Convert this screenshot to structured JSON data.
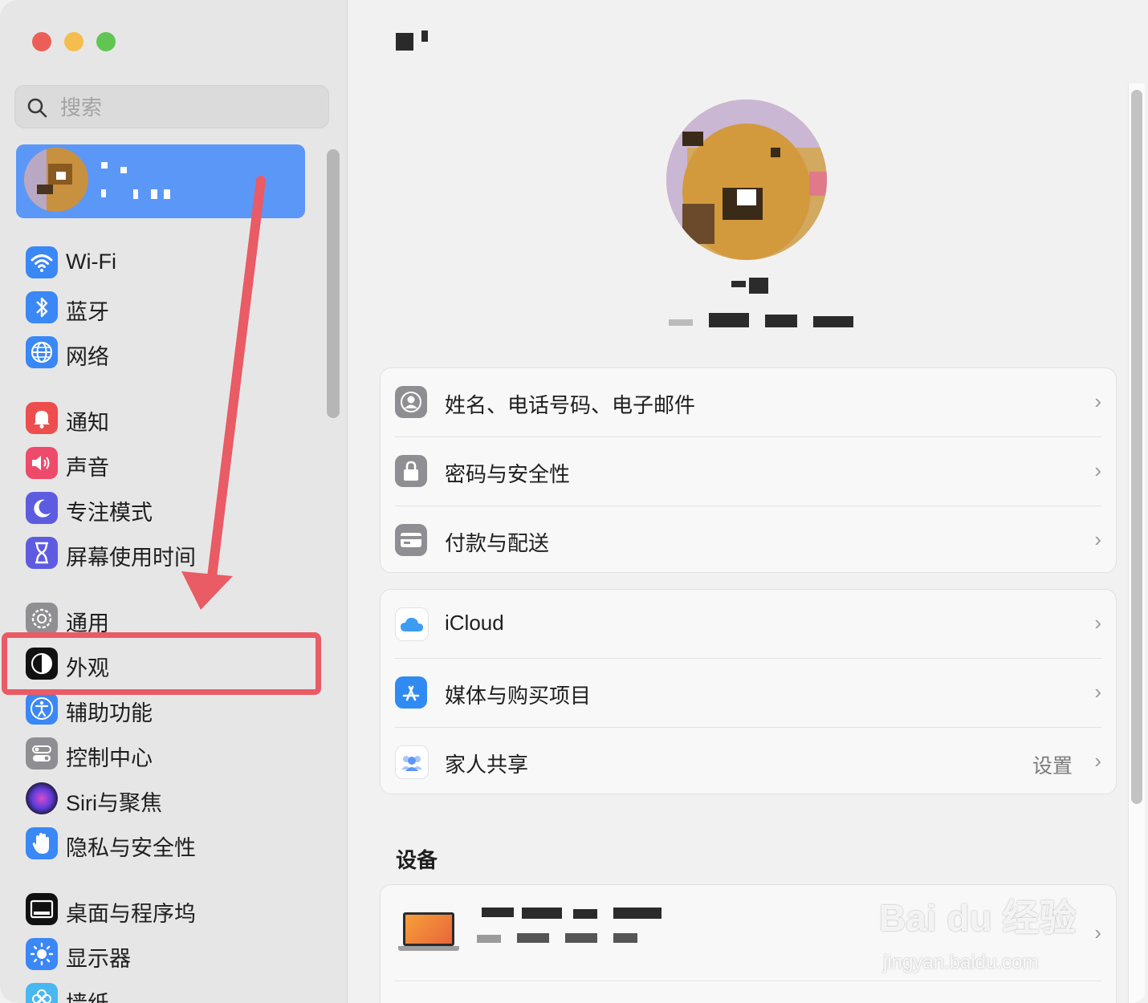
{
  "search": {
    "placeholder": "搜索"
  },
  "sidebar": {
    "items": [
      {
        "label": "Wi-Fi",
        "icon": "wifi-icon"
      },
      {
        "label": "蓝牙",
        "icon": "bluetooth-icon"
      },
      {
        "label": "网络",
        "icon": "globe-icon"
      },
      {
        "label": "通知",
        "icon": "bell-icon"
      },
      {
        "label": "声音",
        "icon": "speaker-icon"
      },
      {
        "label": "专注模式",
        "icon": "moon-icon"
      },
      {
        "label": "屏幕使用时间",
        "icon": "hourglass-icon"
      },
      {
        "label": "通用",
        "icon": "gear-icon"
      },
      {
        "label": "外观",
        "icon": "appearance-icon"
      },
      {
        "label": "辅助功能",
        "icon": "accessibility-icon"
      },
      {
        "label": "控制中心",
        "icon": "control-center-icon"
      },
      {
        "label": "Siri与聚焦",
        "icon": "siri-icon"
      },
      {
        "label": "隐私与安全性",
        "icon": "hand-icon"
      },
      {
        "label": "桌面与程序坞",
        "icon": "dock-icon"
      },
      {
        "label": "显示器",
        "icon": "sun-icon"
      },
      {
        "label": "墙纸",
        "icon": "wallpaper-icon"
      }
    ]
  },
  "groups": {
    "account": [
      {
        "label": "姓名、电话号码、电子邮件",
        "icon": "person-icon"
      },
      {
        "label": "密码与安全性",
        "icon": "lock-icon"
      },
      {
        "label": "付款与配送",
        "icon": "card-icon"
      }
    ],
    "services": [
      {
        "label": "iCloud",
        "icon": "icloud-icon"
      },
      {
        "label": "媒体与购买项目",
        "icon": "appstore-icon"
      },
      {
        "label": "家人共享",
        "icon": "family-icon",
        "value": "设置"
      }
    ]
  },
  "section": {
    "devices": "设备"
  },
  "watermark": {
    "brand": "Bai du 经验",
    "url": "jingyan.baidu.com"
  },
  "colors": {
    "accent": "#5b97f7",
    "annotation": "#e95b65"
  }
}
